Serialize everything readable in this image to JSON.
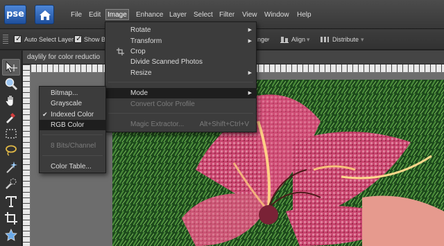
{
  "app": {
    "logo_text": "pse",
    "home_icon": "home-icon"
  },
  "menubar": {
    "items": [
      "File",
      "Edit",
      "Image",
      "Enhance",
      "Layer",
      "Select",
      "Filter",
      "View",
      "Window",
      "Help"
    ],
    "active": "Image"
  },
  "options_bar": {
    "auto_select_label": "Auto Select Layer",
    "show_label": "Show Bo",
    "arrange_label": "nge",
    "align_label": "Align",
    "distribute_label": "Distribute"
  },
  "document": {
    "tab_title": "daylily for color reductio"
  },
  "image_menu": {
    "items": [
      {
        "label": "Rotate",
        "submenu": true
      },
      {
        "label": "Transform",
        "submenu": true
      },
      {
        "label": "Crop",
        "icon": "crop-icon"
      },
      {
        "label": "Divide Scanned Photos"
      },
      {
        "label": "Resize",
        "submenu": true
      },
      {
        "label": "Mode",
        "submenu": true,
        "highlighted": true
      },
      {
        "label": "Convert Color Profile",
        "disabled": true
      },
      {
        "label": "Magic Extractor...",
        "shortcut": "Alt+Shift+Ctrl+V",
        "disabled": true
      }
    ]
  },
  "mode_submenu": {
    "items": [
      {
        "label": "Bitmap..."
      },
      {
        "label": "Grayscale"
      },
      {
        "label": "Indexed Color",
        "checked": true
      },
      {
        "label": "RGB Color",
        "highlighted": true
      },
      {
        "label": "8 Bits/Channel",
        "disabled": true
      },
      {
        "label": "Color Table..."
      }
    ]
  },
  "tools": [
    "move-tool-icon",
    "zoom-tool-icon",
    "hand-tool-icon",
    "eyedropper-tool-icon",
    "marquee-tool-icon",
    "lasso-tool-icon",
    "magic-wand-tool-icon",
    "quick-selection-tool-icon",
    "type-tool-icon",
    "crop-tool-icon",
    "cookie-cutter-tool-icon"
  ],
  "colors": {
    "menu_bg": "#3c3c3c",
    "highlight": "#1e1e1e",
    "brand_blue": "#2f6bc0",
    "petal_pink": "#d2507a",
    "foliage_green": "#2e6b2a"
  }
}
